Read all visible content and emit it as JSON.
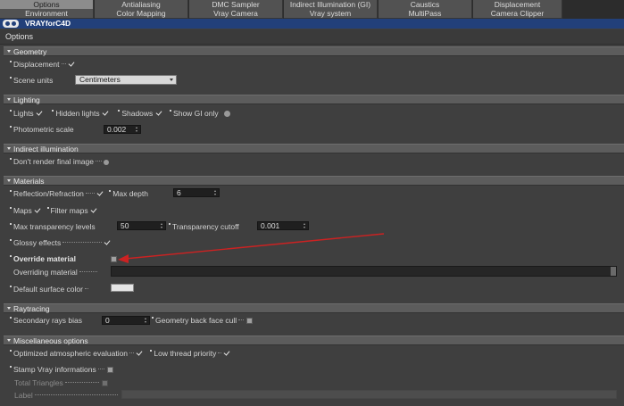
{
  "tabs_row1": [
    {
      "label": "Options",
      "active": true
    },
    {
      "label": "Antialiasing",
      "active": false
    },
    {
      "label": "DMC Sampler",
      "active": false
    },
    {
      "label": "Indirect Illumination (GI)",
      "active": false
    },
    {
      "label": "Caustics",
      "active": false
    },
    {
      "label": "Displacement",
      "active": false
    }
  ],
  "tabs_row2": [
    {
      "label": "Environment"
    },
    {
      "label": "Color Mapping"
    },
    {
      "label": "Vray Camera"
    },
    {
      "label": "Vray system"
    },
    {
      "label": "MultiPass"
    },
    {
      "label": "Camera Clipper"
    }
  ],
  "brand": {
    "text": "VRAYforC4D",
    "logo_icon": "vray-logo-icon",
    "color": "#22407a"
  },
  "panel_title": "Options",
  "sections": {
    "geometry": "Geometry",
    "lighting": "Lighting",
    "indirect": "Indirect illumination",
    "materials": "Materials",
    "raytracing": "Raytracing",
    "misc": "Miscellaneous options"
  },
  "geometry": {
    "displacement_label": "Displacement",
    "displacement_checked": true,
    "scene_units_label": "Scene units",
    "scene_units_value": "Centimeters"
  },
  "lighting": {
    "lights_label": "Lights",
    "hidden_lights_label": "Hidden lights",
    "shadows_label": "Shadows",
    "show_gi_only_label": "Show GI only",
    "photometric_scale_label": "Photometric scale",
    "photometric_scale_value": "0.002"
  },
  "indirect": {
    "dont_render_label": "Don't render final image"
  },
  "materials": {
    "reflection_label": "Reflection/Refraction",
    "max_depth_label": "Max depth",
    "max_depth_value": "6",
    "maps_label": "Maps",
    "filter_maps_label": "Filter maps",
    "max_transparency_label": "Max transparency levels",
    "max_transparency_value": "50",
    "transparency_cutoff_label": "Transparency cutoff",
    "transparency_cutoff_value": "0.001",
    "glossy_label": "Glossy effects",
    "override_material_label": "Override material",
    "overriding_material_label": "Overriding material",
    "default_surface_color_label": "Default surface color",
    "default_surface_color": "#e4e4e4"
  },
  "raytracing": {
    "secondary_bias_label": "Secondary rays bias",
    "secondary_bias_value": "0",
    "back_face_cull_label": "Geometry back face cull"
  },
  "misc": {
    "optimized_atmo_label": "Optimized atmospheric evaluation",
    "low_thread_label": "Low thread priority",
    "stamp_label": "Stamp Vray informations",
    "total_triangles_label": "Total Triangles",
    "label_label": "Label"
  },
  "colors": {
    "annotation_arrow": "#cc2222",
    "background": "#3f3f3f"
  }
}
